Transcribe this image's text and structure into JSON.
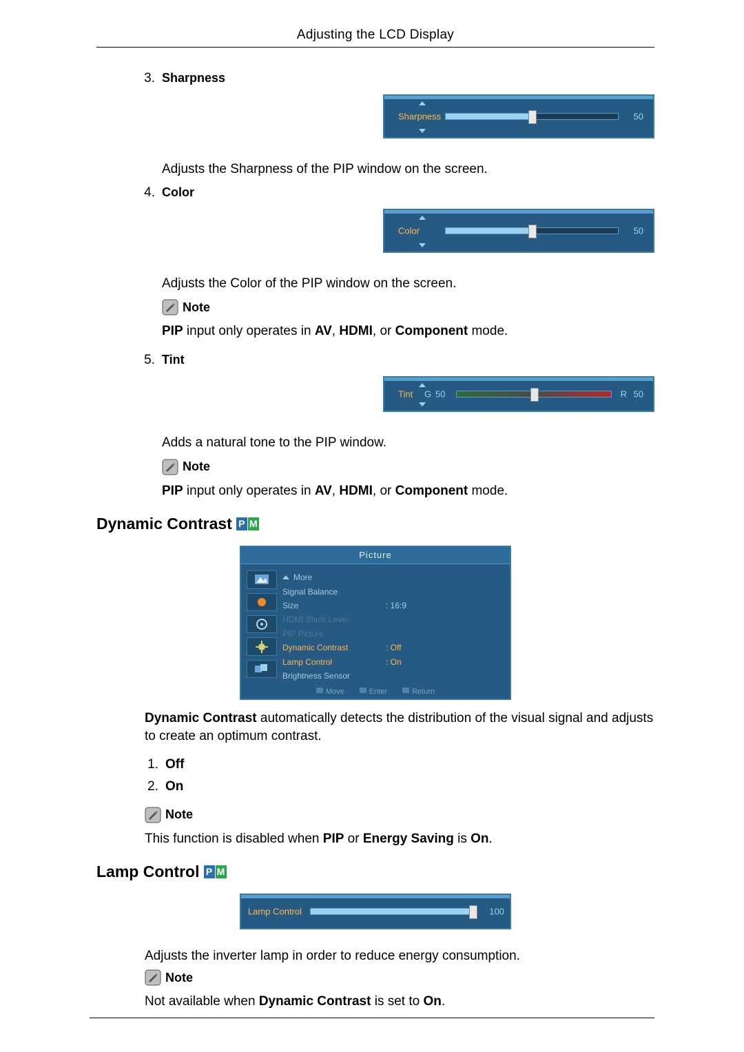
{
  "header": {
    "title": "Adjusting the LCD Display"
  },
  "sharpness": {
    "num": "3.",
    "heading": "Sharpness",
    "osd": {
      "label": "Sharpness",
      "value": "50",
      "percent": 50
    },
    "desc": "Adjusts the Sharpness of the PIP window on the screen."
  },
  "color": {
    "num": "4.",
    "heading": "Color",
    "osd": {
      "label": "Color",
      "value": "50",
      "percent": 50
    },
    "desc": "Adjusts the Color of the PIP window on the screen.",
    "note_label": "Note",
    "note_text_1": "PIP",
    "note_text_2": " input only operates in ",
    "note_text_3": "AV",
    "note_text_4": ", ",
    "note_text_5": "HDMI",
    "note_text_6": ", or ",
    "note_text_7": "Component",
    "note_text_8": " mode."
  },
  "tint": {
    "num": "5.",
    "heading": "Tint",
    "osd": {
      "label": "Tint",
      "g_label": "G",
      "g_val": "50",
      "r_label": "R",
      "r_val": "50",
      "percent": 50
    },
    "desc": "Adds a natural tone to the PIP window.",
    "note_label": "Note",
    "note_text_1": "PIP",
    "note_text_2": " input only operates in ",
    "note_text_3": "AV",
    "note_text_4": ", ",
    "note_text_5": "HDMI",
    "note_text_6": ", or ",
    "note_text_7": "Component",
    "note_text_8": " mode."
  },
  "dynamic": {
    "heading": "Dynamic Contrast",
    "badge_p": "P",
    "badge_m": "M",
    "menu": {
      "title": "Picture",
      "more": "More",
      "rows": [
        {
          "k": "Signal Balance",
          "v": "",
          "cls": ""
        },
        {
          "k": "Size",
          "v": ": 16:9",
          "cls": ""
        },
        {
          "k": "HDMI Black Level",
          "v": "",
          "cls": "dim"
        },
        {
          "k": "PIP Picture",
          "v": "",
          "cls": "dim"
        },
        {
          "k": "Dynamic Contrast",
          "v": ": Off",
          "cls": "sel"
        },
        {
          "k": "Lamp Control",
          "v": ": On",
          "cls": "sel"
        },
        {
          "k": "Brightness Sensor",
          "v": "",
          "cls": ""
        }
      ],
      "hint_move": "Move",
      "hint_enter": "Enter",
      "hint_return": "Return"
    },
    "desc_1": "Dynamic Contrast",
    "desc_2": " automatically detects the distribution of the visual signal and adjusts to create an optimum contrast.",
    "opt1_num": "1.",
    "opt1": "Off",
    "opt2_num": "2.",
    "opt2": "On",
    "note_label": "Note",
    "note_1": "This function is disabled when ",
    "note_2": "PIP",
    "note_3": " or ",
    "note_4": "Energy Saving",
    "note_5": " is ",
    "note_6": "On",
    "note_7": "."
  },
  "lamp": {
    "heading": "Lamp Control",
    "badge_p": "P",
    "badge_m": "M",
    "osd": {
      "label": "Lamp Control",
      "value": "100",
      "percent": 100
    },
    "desc": "Adjusts the inverter lamp in order to reduce energy consumption.",
    "note_label": "Note",
    "note_1": "Not available when ",
    "note_2": "Dynamic Contrast",
    "note_3": " is set to ",
    "note_4": "On",
    "note_5": "."
  }
}
